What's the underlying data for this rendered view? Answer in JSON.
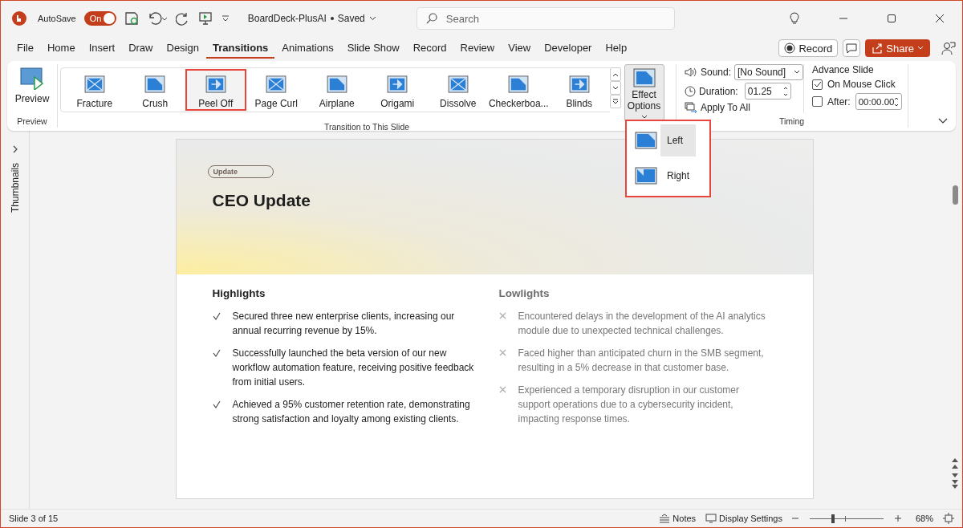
{
  "title_bar": {
    "autosave_label": "AutoSave",
    "autosave_toggle": {
      "label": "On",
      "on": true
    },
    "document_title": "BoardDeck-PlusAI",
    "save_state": "Saved",
    "search": {
      "placeholder": "Search"
    }
  },
  "ribbon_tabs": [
    {
      "label": "File",
      "selected": false
    },
    {
      "label": "Home",
      "selected": false
    },
    {
      "label": "Insert",
      "selected": false
    },
    {
      "label": "Draw",
      "selected": false
    },
    {
      "label": "Design",
      "selected": false
    },
    {
      "label": "Transitions",
      "selected": true
    },
    {
      "label": "Animations",
      "selected": false
    },
    {
      "label": "Slide Show",
      "selected": false
    },
    {
      "label": "Record",
      "selected": false
    },
    {
      "label": "Review",
      "selected": false
    },
    {
      "label": "View",
      "selected": false
    },
    {
      "label": "Developer",
      "selected": false
    },
    {
      "label": "Help",
      "selected": false
    }
  ],
  "ribbon_actions": {
    "record": "Record",
    "share": "Share"
  },
  "preview_group": {
    "button": "Preview",
    "label": "Preview"
  },
  "transition_gallery": {
    "label": "Transition to This Slide",
    "items": [
      {
        "label": "Fracture",
        "selected": false
      },
      {
        "label": "Crush",
        "selected": false
      },
      {
        "label": "Peel Off",
        "selected": true
      },
      {
        "label": "Page Curl",
        "selected": false
      },
      {
        "label": "Airplane",
        "selected": false
      },
      {
        "label": "Origami",
        "selected": false
      },
      {
        "label": "Dissolve",
        "selected": false
      },
      {
        "label": "Checkerboa...",
        "selected": false
      },
      {
        "label": "Blinds",
        "selected": false
      }
    ]
  },
  "effect_options": {
    "label": "Effect Options",
    "menu": {
      "highlighted": true,
      "items": [
        {
          "label": "Left",
          "selected": true
        },
        {
          "label": "Right",
          "selected": false
        }
      ]
    }
  },
  "timing": {
    "label": "Timing",
    "sound_label": "Sound:",
    "sound_value": "[No Sound]",
    "duration_label": "Duration:",
    "duration_value": "01.25",
    "apply_to_all": "Apply To All",
    "advance_slide": "Advance Slide",
    "on_mouse_click": {
      "label": "On Mouse Click",
      "checked": true
    },
    "after": {
      "label": "After:",
      "checked": false,
      "value": "00:00.00"
    }
  },
  "thumbnails_pane": {
    "label": "Thumbnails"
  },
  "slide": {
    "tag": "Update",
    "title": "CEO Update",
    "columns": [
      {
        "heading": "Highlights",
        "kind": "positive",
        "items": [
          "Secured three new enterprise clients, increasing our annual recurring revenue by 15%.",
          "Successfully launched the beta version of our new workflow automation feature, receiving positive feedback from initial users.",
          "Achieved a 95% customer retention rate, demonstrating strong satisfaction and loyalty among existing clients."
        ]
      },
      {
        "heading": "Lowlights",
        "kind": "negative",
        "items": [
          "Encountered delays in the development of the AI analytics module due to unexpected technical challenges.",
          "Faced higher than anticipated churn in the SMB segment, resulting in a 5% decrease in that customer base.",
          "Experienced a temporary disruption in our customer support operations due to a cybersecurity incident, impacting response times."
        ]
      }
    ]
  },
  "status_bar": {
    "slide_info": "Slide 3 of 15",
    "notes": "Notes",
    "display_settings": "Display Settings",
    "zoom": {
      "level": 0.3,
      "reading": "68%"
    }
  }
}
